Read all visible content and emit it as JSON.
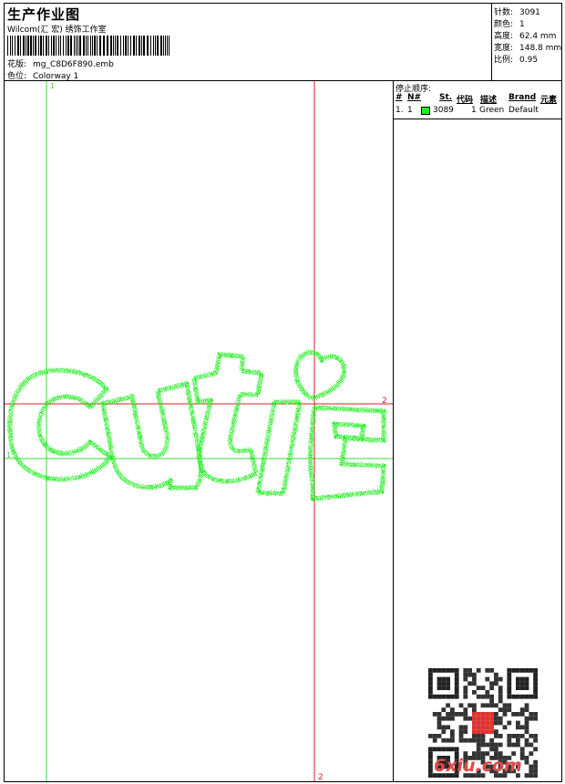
{
  "header": {
    "title": "生产作业图",
    "subtitle": "Wilcom(汇 宏) 绣饰工作室",
    "file_label": "花版:",
    "file_value": "mg_C8D6F890.emb",
    "colorway_label": "色位:",
    "colorway_value": "Colorway 1"
  },
  "stats": [
    {
      "label": "针数:",
      "value": "3091"
    },
    {
      "label": "颜色:",
      "value": "1"
    },
    {
      "label": "高度:",
      "value": "62.4 mm"
    },
    {
      "label": "宽度:",
      "value": "148.8 mm"
    },
    {
      "label": "比例:",
      "value": "0.95"
    }
  ],
  "stop_sequence": {
    "title": "停止顺序:",
    "columns": [
      "#",
      "N#",
      "St.",
      "代码",
      "描述",
      "Brand",
      "元素"
    ],
    "rows": [
      {
        "index": "1.",
        "needle": "1",
        "stitches": "3089",
        "code": "1",
        "description": "Green",
        "brand": "Default",
        "color": "#22ee22"
      }
    ]
  },
  "design": {
    "guide_labels": {
      "green_top": "1",
      "green_left": "1",
      "red_right": "2",
      "red_bottom": "2"
    },
    "thread_color": "#22ee22",
    "guide_green": "#33dd33",
    "guide_red": "#dd2222"
  },
  "logo": {
    "main": "6xiu",
    "suffix": ".com"
  }
}
